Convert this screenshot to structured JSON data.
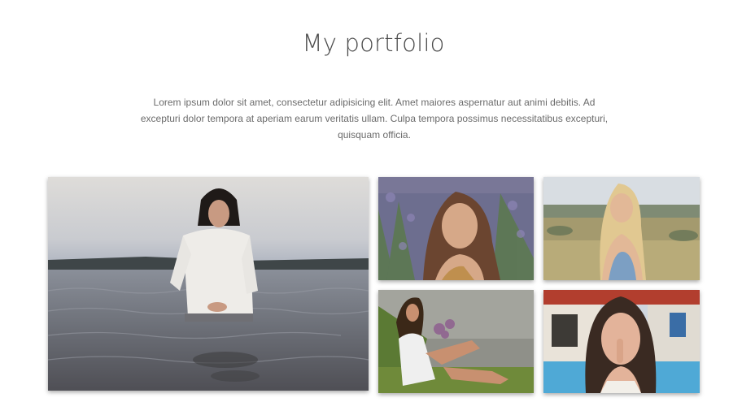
{
  "page": {
    "title": "My portfolio",
    "description": "Lorem ipsum dolor sit amet, consectetur adipisicing elit. Amet maiores aspernatur aut animi debitis. Ad excepturi dolor tempora at aperiam earum veritatis ullam. Culpa tempora possimus necessitatibus excepturi, quisquam officia."
  },
  "portfolio": {
    "items": [
      {
        "icon": "photo-woman-in-sea"
      },
      {
        "icon": "photo-woman-in-lavender-field"
      },
      {
        "icon": "photo-blonde-woman-in-field"
      },
      {
        "icon": "photo-woman-sitting-on-grass"
      },
      {
        "icon": "photo-woman-finger-on-lips"
      }
    ]
  },
  "colors": {
    "title": "#4a4a4a",
    "text": "#6b6b6b",
    "background": "#ffffff"
  }
}
